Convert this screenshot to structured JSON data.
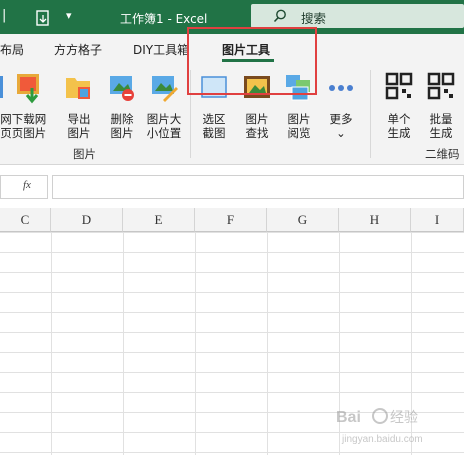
{
  "titlebar": {
    "title": "工作簿1 - Excel",
    "search_placeholder": "搜索",
    "save_icon": "save-icon",
    "search_icon": "search-icon"
  },
  "tabs": [
    {
      "label": "布局"
    },
    {
      "label": "方方格子"
    },
    {
      "label": "DIY工具箱"
    },
    {
      "label": "图片工具",
      "active": true
    }
  ],
  "ribbon": {
    "buttons": [
      {
        "label1": "网",
        "label2": "页"
      },
      {
        "label1": "下载网",
        "label2": "页图片"
      },
      {
        "label1": "导出",
        "label2": "图片"
      },
      {
        "label1": "删除",
        "label2": "图片"
      },
      {
        "label1": "图片大",
        "label2": "小位置"
      },
      {
        "label1": "选区",
        "label2": "截图"
      },
      {
        "label1": "图片",
        "label2": "查找"
      },
      {
        "label1": "图片",
        "label2": "阅览"
      },
      {
        "label1": "更多",
        "label2": "⌄"
      },
      {
        "label1": "单个",
        "label2": "生成"
      },
      {
        "label1": "批量",
        "label2": "生成"
      }
    ],
    "group_labels": [
      "图片",
      "二维码"
    ]
  },
  "formula_bar": {
    "fx_label": "fx",
    "value": ""
  },
  "columns": [
    "C",
    "D",
    "E",
    "F",
    "G",
    "H",
    "I"
  ],
  "colors": {
    "accent": "#217346",
    "highlight": "#e04040"
  }
}
